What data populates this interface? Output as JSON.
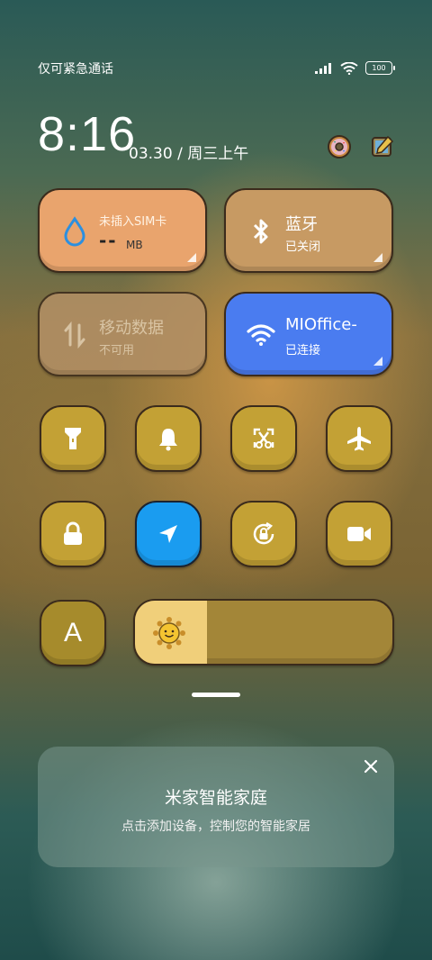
{
  "status": {
    "carrier": "仅可紧急通话",
    "battery": "100"
  },
  "clock": {
    "time": "8:16",
    "date": "03.30 / 周三上午"
  },
  "header_icons": [
    "donut-icon",
    "edit-icon"
  ],
  "tiles": {
    "data_usage": {
      "title": "未插入SIM卡",
      "value": "--",
      "unit": "MB",
      "color": "#e9a46d"
    },
    "bluetooth": {
      "title": "蓝牙",
      "status": "已关闭",
      "color": "#c79a63"
    },
    "mobile_data": {
      "title": "移动数据",
      "status": "不可用",
      "color": "#b39066"
    },
    "wifi": {
      "title": "MIOffice-",
      "status": "已连接",
      "color": "#4a7cf0"
    }
  },
  "toggles": [
    {
      "name": "flashlight",
      "icon": "flashlight-icon",
      "active": false
    },
    {
      "name": "ring",
      "icon": "bell-icon",
      "active": false
    },
    {
      "name": "screenshot",
      "icon": "scissors-icon",
      "active": false
    },
    {
      "name": "airplane",
      "icon": "airplane-icon",
      "active": false
    },
    {
      "name": "lock-screen",
      "icon": "lock-icon",
      "active": false
    },
    {
      "name": "location",
      "icon": "location-arrow-icon",
      "active": true
    },
    {
      "name": "rotation-lock",
      "icon": "rotation-lock-icon",
      "active": false
    },
    {
      "name": "screen-record",
      "icon": "video-camera-icon",
      "active": false
    }
  ],
  "auto_brightness": {
    "label": "A"
  },
  "brightness": {
    "level": 0.28
  },
  "smart_home": {
    "title": "米家智能家庭",
    "subtitle": "点击添加设备，控制您的智能家居"
  },
  "colors": {
    "toggle_bg": "#c3a135",
    "toggle_active": "#1a9cf0",
    "outline": "#3b2b1c"
  }
}
